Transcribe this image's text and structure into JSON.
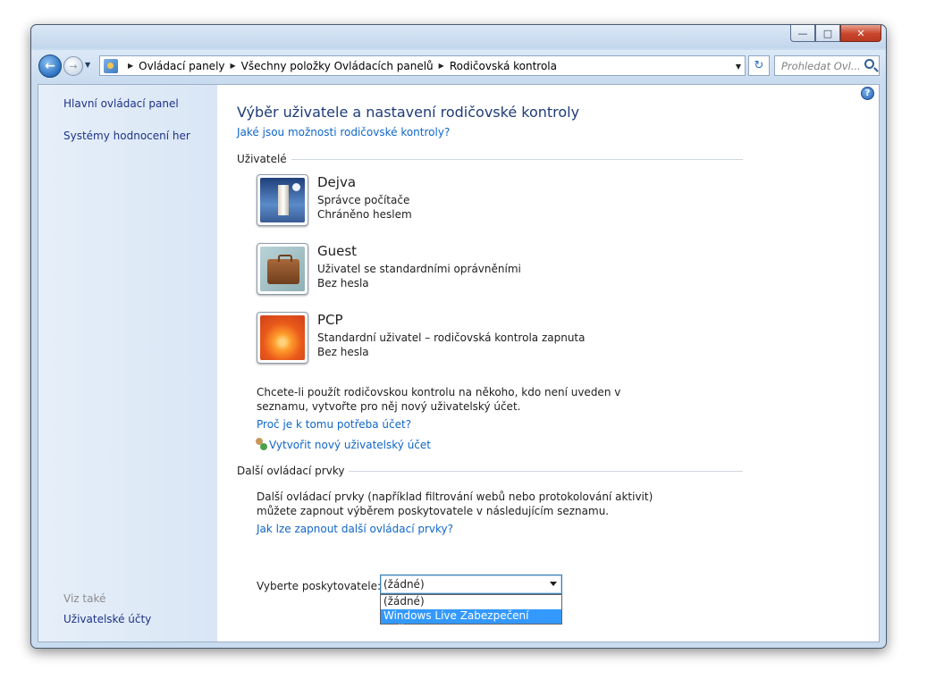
{
  "window": {
    "caption": {
      "minimize": "—",
      "maximize": "□",
      "close": "✕"
    }
  },
  "addressbar": {
    "breadcrumbs": [
      "Ovládací panely",
      "Všechny položky Ovládacích panelů",
      "Rodičovská kontrola"
    ],
    "search_placeholder": "Prohledat Ovl..."
  },
  "sidebar": {
    "links": [
      "Hlavní ovládací panel",
      "Systémy hodnocení her"
    ],
    "see_also_heading": "Viz také",
    "see_also_links": [
      "Uživatelské účty"
    ]
  },
  "main": {
    "title": "Výběr uživatele a nastavení rodičovské kontroly",
    "title_link": "Jaké jsou možnosti rodičovské kontroly?",
    "users_heading": "Uživatelé",
    "users": [
      {
        "name": "Dejva",
        "line1": "Správce počítače",
        "line2": "Chráněno heslem"
      },
      {
        "name": "Guest",
        "line1": "Uživatel se standardními oprávněními",
        "line2": "Bez hesla"
      },
      {
        "name": "PCP",
        "line1": "Standardní uživatel – rodičovská kontrola zapnuta",
        "line2": "Bez hesla"
      }
    ],
    "info_line1": "Chcete-li použít rodičovskou kontrolu na někoho, kdo není uveden v",
    "info_line2": "seznamu, vytvořte pro něj nový uživatelský účet.",
    "why_link": "Proč je k tomu potřeba účet?",
    "create_link": "Vytvořit nový uživatelský účet",
    "more_heading": "Další ovládací prvky",
    "more_line1": "Další ovládací prvky (například filtrování webů nebo protokolování aktivit)",
    "more_line2": "můžete zapnout výběrem poskytovatele v následujícím seznamu.",
    "more_link": "Jak lze zapnout další ovládací prvky?",
    "provider_label": "Vyberte poskytovatele:",
    "provider_selected": "(žádné)",
    "provider_options": [
      "(žádné)",
      "Windows Live Zabezpečení rodiny"
    ]
  }
}
